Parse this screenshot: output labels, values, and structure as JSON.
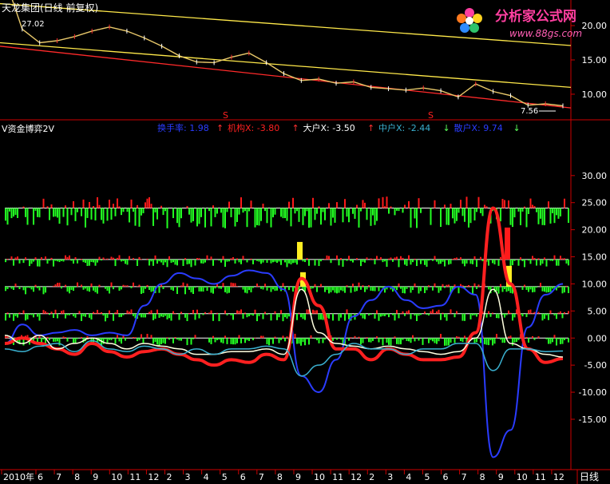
{
  "header": {
    "title": "天龙集团(日线 前复权)",
    "low_marker": "27.02",
    "watermark_brand": "分析家公式网",
    "watermark_url": "www.88gs.com"
  },
  "indicator": {
    "name": "V资金博弈2V",
    "items": [
      {
        "label": "换手率:",
        "value": "1.98",
        "arrow": "↑",
        "color": "#2a3cff"
      },
      {
        "label": "机构X:",
        "value": "-3.80",
        "arrow": "↑",
        "color": "#ff2020"
      },
      {
        "label": "大户X:",
        "value": "-3.50",
        "arrow": "↑",
        "color": "#ffffff"
      },
      {
        "label": "中户X:",
        "value": "-2.44",
        "arrow": "↓",
        "color": "#3ab0d0"
      },
      {
        "label": "散户X:",
        "value": "9.74",
        "arrow": "↓",
        "color": "#2a3cff"
      }
    ]
  },
  "chart_data": [
    {
      "type": "line",
      "title": "天龙集团(日线 前复权)",
      "yticks": [
        "20.00",
        "15.00",
        "10.00"
      ],
      "ylim": [
        6.5,
        23.5
      ],
      "annotations": [
        "27.02",
        "7.56",
        "S",
        "S"
      ],
      "series": [
        {
          "name": "price",
          "values": [
            27.0,
            19.5,
            17.5,
            17.8,
            18.4,
            19.2,
            19.8,
            19.2,
            18.2,
            17.0,
            15.6,
            14.7,
            14.6,
            15.4,
            16.0,
            14.6,
            13.0,
            12.0,
            12.2,
            11.6,
            11.8,
            11.0,
            10.8,
            10.6,
            10.9,
            10.5,
            9.6,
            11.5,
            10.4,
            9.8,
            8.4,
            8.6,
            8.3
          ]
        }
      ],
      "channel_upper": [
        [
          0,
          23.2
        ],
        [
          1,
          17.1
        ]
      ],
      "channel_lower": [
        [
          0,
          17.5
        ],
        [
          1,
          11.0
        ]
      ],
      "trend_line": [
        [
          0,
          17.0
        ],
        [
          1,
          8.0
        ]
      ]
    },
    {
      "type": "line",
      "title": "V资金博弈2V",
      "yticks": [
        "30.00",
        "25.00",
        "20.00",
        "15.00",
        "10.00",
        "5.00",
        "0.00",
        "-5.00",
        "-10.00",
        "-15.00"
      ],
      "ylim": [
        -24,
        40
      ],
      "reference_levels": [
        24,
        14.5,
        9.5,
        4.5,
        0
      ],
      "series": [
        {
          "name": "换手率",
          "color": "#2a3cff",
          "values": [
            -1,
            2.5,
            0.5,
            1,
            1.5,
            0.5,
            1,
            0.5,
            6,
            10,
            12,
            11,
            10,
            11.5,
            12.5,
            12,
            9,
            -7,
            -10,
            -4,
            4,
            7,
            9.5,
            7,
            5.5,
            6,
            9.5,
            8,
            -22,
            -17,
            2,
            8,
            10
          ]
        },
        {
          "name": "机构X",
          "color": "#ff2020",
          "values": [
            -1,
            0,
            -1,
            -2,
            -3,
            -1,
            -2.5,
            -3.5,
            -2.5,
            -2,
            -3,
            -4,
            -5,
            -4,
            -4.5,
            -3,
            -4,
            11,
            6,
            -2,
            -2,
            -4,
            -2,
            -3,
            -4,
            -4,
            -3.5,
            1,
            24,
            10,
            -2,
            -4.5,
            -3.8
          ]
        },
        {
          "name": "大户X",
          "color": "#ffffe0",
          "values": [
            0.5,
            -1,
            0.5,
            -2,
            -1,
            0,
            -1,
            -2,
            -1,
            -1.5,
            -2,
            -3,
            -3,
            -2.5,
            -2.5,
            -2,
            -3,
            9,
            1,
            -1,
            -1.5,
            -2,
            -1.5,
            -2,
            -2.5,
            -3,
            -2.5,
            0,
            9,
            -1,
            -2,
            -3,
            -3.5
          ]
        },
        {
          "name": "中户X",
          "color": "#3ab0d0",
          "values": [
            -2,
            -2.5,
            -1.5,
            -1,
            -2.5,
            -0.5,
            -2,
            -2.5,
            -1.5,
            -2,
            -3,
            -2,
            -3,
            -2,
            -2,
            -1.5,
            -2,
            -7,
            -5,
            -3,
            -1,
            -2,
            -2,
            -3,
            -2,
            -2,
            -1,
            -1,
            -6,
            -2,
            -2,
            -2.5,
            -2.4
          ]
        }
      ]
    }
  ],
  "xaxis": {
    "labels": [
      "2010年",
      "6",
      "7",
      "8",
      "9",
      "10",
      "11",
      "12",
      "2",
      "3",
      "4",
      "5",
      "6",
      "7",
      "8",
      "9",
      "10",
      "11",
      "12",
      "2",
      "3",
      "4",
      "5",
      "6",
      "7",
      "8",
      "9",
      "10",
      "11",
      "12"
    ],
    "period": "日线"
  },
  "colors": {
    "background": "#000000",
    "axis": "#cc0000",
    "volume_up": "#ff1a1a",
    "volume_down": "#22ff22",
    "highlight": "#ffee22"
  }
}
